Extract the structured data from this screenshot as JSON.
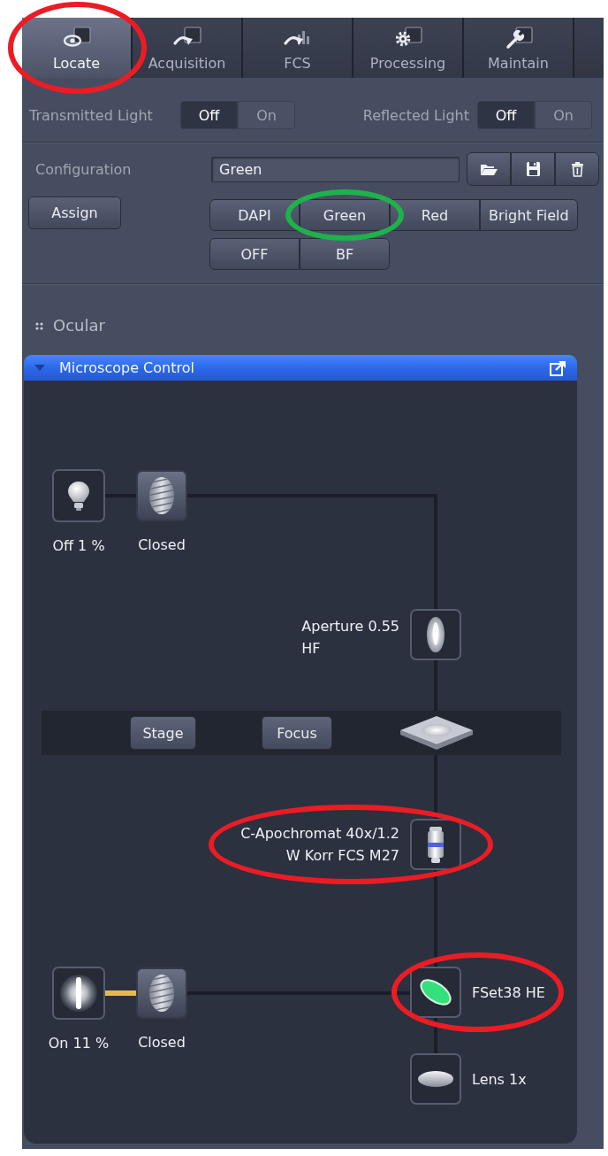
{
  "tabs": [
    {
      "label": "Locate",
      "selected": true,
      "annotation": {
        "kind": "ellipse",
        "color": "#ec1c24"
      }
    },
    {
      "label": "Acquisition",
      "selected": false
    },
    {
      "label": "FCS",
      "selected": false
    },
    {
      "label": "Processing",
      "selected": false
    },
    {
      "label": "Maintain",
      "selected": false
    }
  ],
  "light_switches": [
    {
      "label": "Transmitted Light",
      "options": [
        {
          "label": "Off",
          "selected": true
        },
        {
          "label": "On",
          "selected": false
        }
      ]
    },
    {
      "label": "Reflected Light",
      "options": [
        {
          "label": "Off",
          "selected": true
        },
        {
          "label": "On",
          "selected": false
        }
      ]
    }
  ],
  "configuration": {
    "label": "Configuration",
    "value": "Green",
    "assign_button": "Assign",
    "preset_rows": [
      [
        {
          "label": "DAPI"
        },
        {
          "label": "Green",
          "annotation": {
            "kind": "ellipse",
            "color": "#1fb24a"
          }
        },
        {
          "label": "Red"
        },
        {
          "label": "Bright Field"
        }
      ],
      [
        {
          "label": "OFF"
        },
        {
          "label": "BF"
        }
      ]
    ]
  },
  "ocular": {
    "label": "Ocular"
  },
  "microscope_control": {
    "title": "Microscope Control",
    "expanded": true,
    "transmitted_path": {
      "lamp": {
        "on": false,
        "label": "Off 1 %"
      },
      "diaphragm": {
        "label": "Closed"
      }
    },
    "condenser": {
      "lines": [
        "Aperture 0.55",
        "HF"
      ]
    },
    "stage_bar": {
      "buttons": [
        "Stage",
        "Focus"
      ]
    },
    "objective": {
      "lines": [
        "C-Apochromat 40x/1.2",
        "W Korr FCS M27"
      ],
      "annotation": {
        "kind": "ellipse",
        "color": "#ec1c24"
      }
    },
    "reflected_path": {
      "lamp": {
        "on": true,
        "label": "On 11 %"
      },
      "diaphragm": {
        "label": "Closed"
      }
    },
    "reflector": {
      "label": "FSet38 HE",
      "annotation": {
        "kind": "ellipse",
        "color": "#ec1c24"
      }
    },
    "tube_lens": {
      "label": "Lens 1x"
    }
  }
}
